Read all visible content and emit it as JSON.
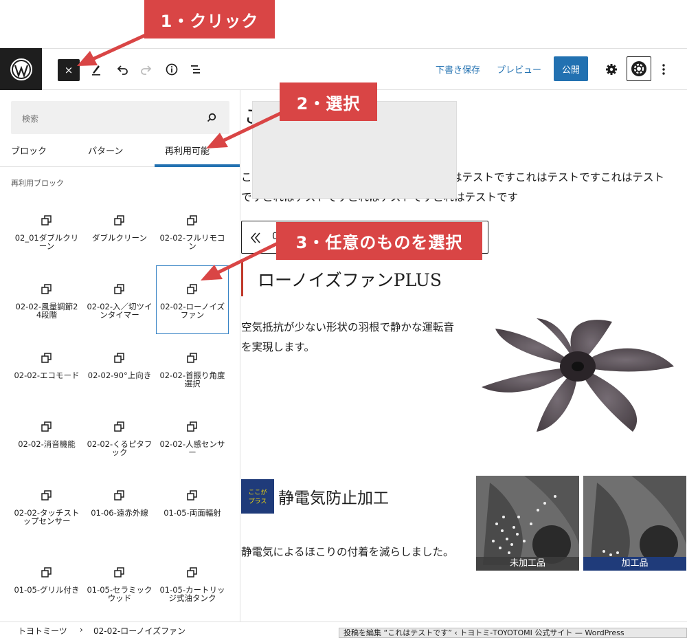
{
  "callouts": {
    "step1": "1・クリック",
    "step2": "2・選択",
    "step3": "3・任意のものを選択"
  },
  "toolbar": {
    "close_label": "×",
    "save_draft": "下書き保存",
    "preview": "プレビュー",
    "publish": "公開"
  },
  "sidebar": {
    "search_placeholder": "検索",
    "tabs": [
      "ブロック",
      "パターン",
      "再利用可能"
    ],
    "active_tab": "再利用可能",
    "section_label": "再利用ブロック",
    "blocks": [
      "02_01ダブルクリーン",
      "ダブルクリーン",
      "02-02-フルリモコン",
      "02-02-風量調節24段階",
      "02-02-入／切ツインタイマー",
      "02-02-ローノイズファン",
      "02-02-エコモード",
      "02-02-90°上向き",
      "02-02-首振り角度選択",
      "02-02-消音機能",
      "02-02-くるピタフック",
      "02-02-人感センサー",
      "02-02-タッチストップセンサー",
      "01-06-遠赤外線",
      "01-05-両面輻射",
      "01-05-グリル付き",
      "01-05-セラミックウッド",
      "01-05-カートリッジ式油タンク"
    ],
    "selected_block": "02-02-ローノイズファン"
  },
  "content": {
    "title_fragment": "こ",
    "para1_line1_a": "こ",
    "para1_line1_b": "はテストですこれはテストですこれはテスト",
    "para1_line2": "ですこれはテストですこれはテストですこれはテストです",
    "reusable_code": "0",
    "heading": "ローノイズファンPLUS",
    "para2": "空気抵抗が少ない形状の羽根で静かな運転音を実現します。",
    "badge_top": "ここが",
    "badge_bottom": "プラス",
    "h2": "静電気防止加工",
    "para3": "静電気によるほこりの付着を減らしました。",
    "photo1_caption": "未加工品",
    "photo2_caption": "加工品"
  },
  "footer": {
    "breadcrumb_root": "トヨトミーツ",
    "separator": "›",
    "breadcrumb_current": "02-02-ローノイズファン",
    "window_title": "投稿を編集 “これはテストです” ‹ トヨトミ-TOYOTOMI 公式サイト — WordPress"
  },
  "colors": {
    "accent": "#2271b1",
    "callout": "#d94545",
    "dark": "#1e1e1e"
  }
}
